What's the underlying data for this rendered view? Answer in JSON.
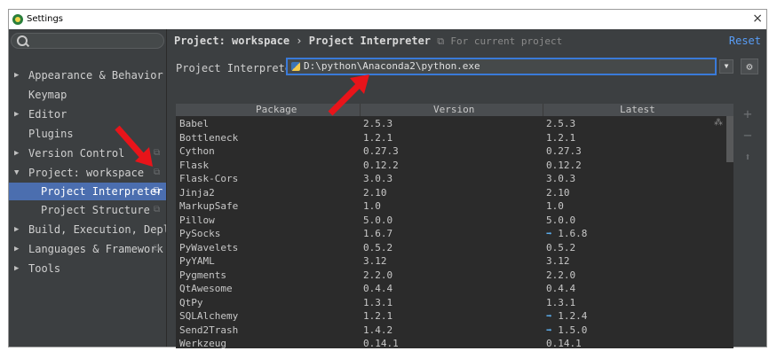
{
  "window": {
    "title": "Settings",
    "close_glyph": "×"
  },
  "sidebar": {
    "search_placeholder": "",
    "items": [
      {
        "label": "Appearance & Behavior",
        "arrow": "▶",
        "copy": ""
      },
      {
        "label": "Keymap",
        "arrow": "",
        "copy": ""
      },
      {
        "label": "Editor",
        "arrow": "▶",
        "copy": ""
      },
      {
        "label": "Plugins",
        "arrow": "",
        "copy": ""
      },
      {
        "label": "Version Control",
        "arrow": "▶",
        "copy": "⧉"
      },
      {
        "label": "Project: workspace",
        "arrow": "▼",
        "copy": "⧉"
      },
      {
        "label": "Project Interpreter",
        "arrow": "",
        "copy": "⧉"
      },
      {
        "label": "Project Structure",
        "arrow": "",
        "copy": "⧉"
      },
      {
        "label": "Build, Execution, Deplo",
        "arrow": "▶",
        "copy": ""
      },
      {
        "label": "Languages & Framework",
        "arrow": "▶",
        "copy": "⧉"
      },
      {
        "label": "Tools",
        "arrow": "▶",
        "copy": ""
      }
    ]
  },
  "header": {
    "breadcrumb_project": "Project: workspace",
    "breadcrumb_sep": "›",
    "breadcrumb_page": "Project Interpreter",
    "hint_icon": "copy-icon",
    "hint": "For current project",
    "reset": "Reset"
  },
  "interpreter": {
    "label": "Project Interpreter:",
    "value": "D:\\python\\Anaconda2\\python.exe"
  },
  "table": {
    "columns": [
      "Package",
      "Version",
      "Latest"
    ],
    "rows": [
      {
        "package": "Babel",
        "version": "2.5.3",
        "latest": "2.5.3",
        "update": false
      },
      {
        "package": "Bottleneck",
        "version": "1.2.1",
        "latest": "1.2.1",
        "update": false
      },
      {
        "package": "Cython",
        "version": "0.27.3",
        "latest": "0.27.3",
        "update": false
      },
      {
        "package": "Flask",
        "version": "0.12.2",
        "latest": "0.12.2",
        "update": false
      },
      {
        "package": "Flask-Cors",
        "version": "3.0.3",
        "latest": "3.0.3",
        "update": false
      },
      {
        "package": "Jinja2",
        "version": "2.10",
        "latest": "2.10",
        "update": false
      },
      {
        "package": "MarkupSafe",
        "version": "1.0",
        "latest": "1.0",
        "update": false
      },
      {
        "package": "Pillow",
        "version": "5.0.0",
        "latest": "5.0.0",
        "update": false
      },
      {
        "package": "PySocks",
        "version": "1.6.7",
        "latest": "1.6.8",
        "update": true
      },
      {
        "package": "PyWavelets",
        "version": "0.5.2",
        "latest": "0.5.2",
        "update": false
      },
      {
        "package": "PyYAML",
        "version": "3.12",
        "latest": "3.12",
        "update": false
      },
      {
        "package": "Pygments",
        "version": "2.2.0",
        "latest": "2.2.0",
        "update": false
      },
      {
        "package": "QtAwesome",
        "version": "0.4.4",
        "latest": "0.4.4",
        "update": false
      },
      {
        "package": "QtPy",
        "version": "1.3.1",
        "latest": "1.3.1",
        "update": false
      },
      {
        "package": "SQLAlchemy",
        "version": "1.2.1",
        "latest": "1.2.4",
        "update": true
      },
      {
        "package": "Send2Trash",
        "version": "1.4.2",
        "latest": "1.5.0",
        "update": true
      },
      {
        "package": "Werkzeug",
        "version": "0.14.1",
        "latest": "0.14.1",
        "update": false
      }
    ]
  },
  "tools": {
    "add": "+",
    "remove": "−",
    "upgrade": "⬆"
  },
  "colors": {
    "accent": "#4b6eaf",
    "link": "#589df6",
    "update_arrow": "#5aa9e6",
    "annotation_arrow": "#e8141a"
  }
}
